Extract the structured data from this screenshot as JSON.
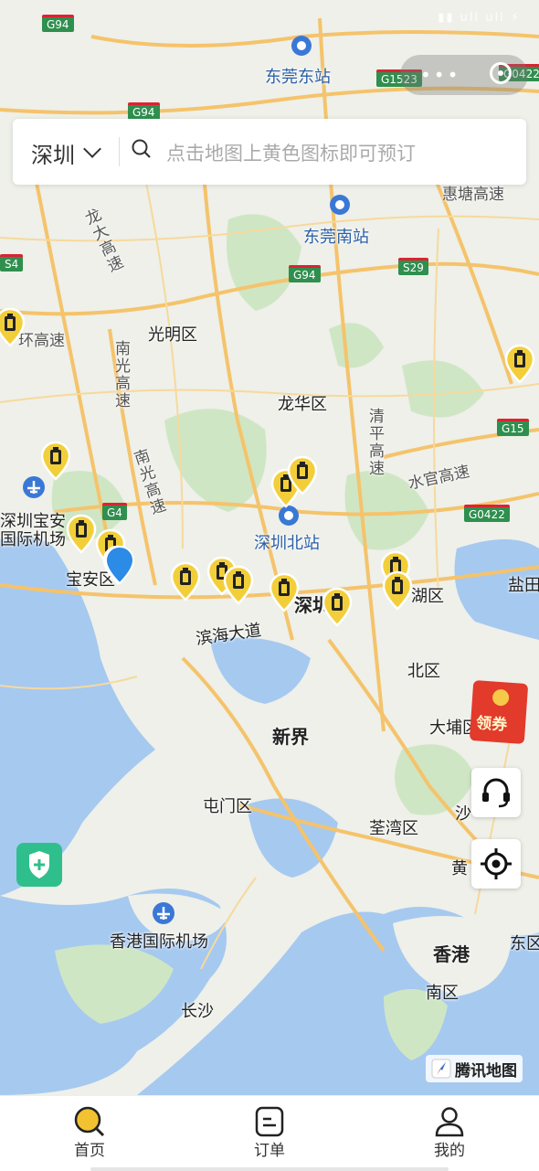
{
  "status_bar": {
    "icons_text": "▮▮ ull ull ⚡"
  },
  "search": {
    "city": "深圳",
    "placeholder": "点击地图上黄色图标即可预订"
  },
  "map": {
    "labels": {
      "dongguan_east": "东莞东站",
      "dongguan_south": "东莞南站",
      "guangming": "光明区",
      "longhua": "龙华区",
      "shenzhen_north": "深圳北站",
      "baoan_airport_1": "深圳宝安",
      "baoan_airport_2": "国际机场",
      "baoan": "宝安区",
      "binhai": "滨海大道",
      "futian": "深圳",
      "longgang": "盐田",
      "yantian_district": "湖区",
      "north_district": "北区",
      "dapu": "大埔区",
      "new_territories": "新界",
      "tuen_mun": "屯门区",
      "tsuen_wan": "荃湾区",
      "sha": "沙",
      "huang": "黄",
      "hk_airport": "香港国际机场",
      "hong_kong": "香港",
      "southern": "南区",
      "east": "东区",
      "changsha": "长沙",
      "huanhuan": "环高速",
      "shuiguan": "水官高速",
      "huitang": "惠塘高速",
      "longda": "龙大高速",
      "nanguang": "南光高速",
      "qingping": "清平高速"
    },
    "shields": {
      "g94_top": "G94",
      "g94_mid": "G94",
      "g1523": "G1523",
      "g0422_top": "G0422",
      "s29": "S29",
      "g15": "G15",
      "g4": "G4",
      "g0422": "G0422",
      "g94_left": "G94",
      "s4": "S4"
    },
    "pin_count": 16
  },
  "buttons": {
    "coupon": "领券",
    "customer_service": "headset-icon",
    "locate": "locate-icon",
    "shield": "shield-plus-icon"
  },
  "map_logo": "腾讯地图",
  "tabs": [
    {
      "label": "首页",
      "icon": "search-icon",
      "active": true
    },
    {
      "label": "订单",
      "icon": "order-icon",
      "active": false
    },
    {
      "label": "我的",
      "icon": "user-icon",
      "active": false
    }
  ],
  "colors": {
    "accent": "#f2c230",
    "pin": "#f2cf3a",
    "coupon": "#e23a2b",
    "shield_btn": "#2fbf8d"
  }
}
